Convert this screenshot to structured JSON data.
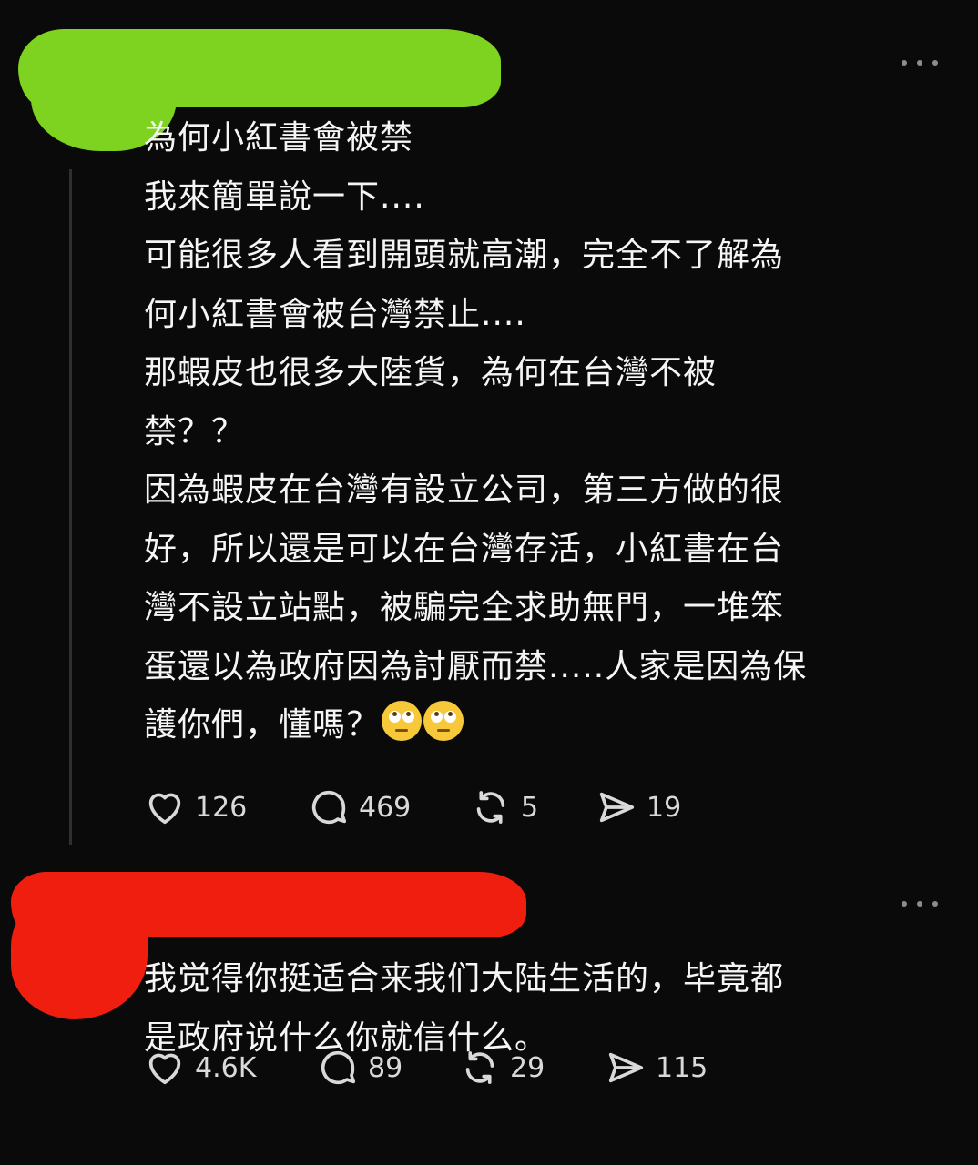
{
  "posts": [
    {
      "body": "為何小紅書會被禁\n我來簡單說一下....\n可能很多人看到開頭就高潮，完全不了解為\n何小紅書會被台灣禁止....\n那蝦皮也很多大陸貨，為何在台灣不被\n禁？？\n因為蝦皮在台灣有設立公司，第三方做的很\n好，所以還是可以在台灣存活，小紅書在台\n灣不設立站點，被騙完全求助無門，一堆笨\n蛋還以為政府因為討厭而禁.....人家是因為保\n護你們，懂嗎？",
      "emoji": "face-with-rolling-eyes",
      "emoji_count": 2,
      "redaction_color": "#7ed321",
      "likes": "126",
      "replies": "469",
      "reposts": "5",
      "shares": "19"
    },
    {
      "body": "我觉得你挺适合来我们大陆生活的，毕竟都\n是政府说什么你就信什么。",
      "redaction_color": "#f01e0e",
      "likes": "4.6K",
      "replies": "89",
      "reposts": "29",
      "shares": "115"
    }
  ],
  "icons": {
    "like": "heart-icon",
    "reply": "comment-icon",
    "repost": "repost-icon",
    "share": "send-icon",
    "more": "more-options-icon"
  }
}
